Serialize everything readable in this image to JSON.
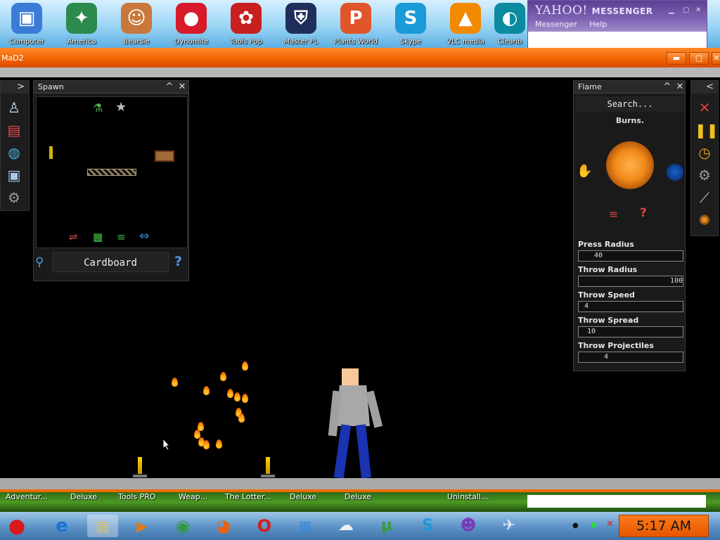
{
  "desktop": {
    "icons": [
      {
        "label": "Computer",
        "icon": "computer-icon",
        "color": "#3b7bd8",
        "glyph": "▣"
      },
      {
        "label": "America",
        "icon": "globe-compass-icon",
        "color": "#2c8a4c",
        "glyph": "✦"
      },
      {
        "label": "Bearsie",
        "icon": "girl-face-icon",
        "color": "#c9773b",
        "glyph": "☺"
      },
      {
        "label": "Dynomite",
        "icon": "mushroom-ball-icon",
        "color": "#d81a2a",
        "glyph": "●"
      },
      {
        "label": "Tools Pop",
        "icon": "turkey-icon",
        "color": "#c81f1f",
        "glyph": "✿"
      },
      {
        "label": "Master PL",
        "icon": "shield-mpl-icon",
        "color": "#1f2e5a",
        "glyph": "⛨"
      },
      {
        "label": "Plants World",
        "icon": "p-badge-icon",
        "color": "#e0552a",
        "glyph": "P"
      },
      {
        "label": "Skype",
        "icon": "skype-icon",
        "color": "#1a9ad8",
        "glyph": "S"
      },
      {
        "label": "VLC media",
        "icon": "vlc-cone-icon",
        "color": "#f28a00",
        "glyph": "▲"
      },
      {
        "label": "Cleanb",
        "icon": "cleaner-icon",
        "color": "#0b8aa0",
        "glyph": "◐"
      }
    ]
  },
  "yahoo": {
    "brand": "YAHOO!",
    "sub": "MESSENGER",
    "menu": [
      "Messenger",
      "Help"
    ]
  },
  "window": {
    "title": "MaD2",
    "min": "▬",
    "max": "□",
    "close": "✕"
  },
  "spawn": {
    "title": "Spawn",
    "collapse": "^",
    "close": "✕",
    "search_label": "Cardboard",
    "help": "?"
  },
  "flame": {
    "title": "Flame",
    "collapse": "^",
    "close": "✕",
    "search_placeholder": "Search...",
    "description": "Burns.",
    "help": "?",
    "fields": [
      {
        "label": "Press Radius",
        "value": "40"
      },
      {
        "label": "Throw Radius",
        "value": "100"
      },
      {
        "label": "Throw Speed",
        "value": "4"
      },
      {
        "label": "Throw Spread",
        "value": "10"
      },
      {
        "label": "Throw Projectiles",
        "value": "4"
      }
    ]
  },
  "left_toolbar": {
    "expand": ">"
  },
  "right_toolbar": {
    "expand": "<"
  },
  "taskbar_top": {
    "items": [
      "Adventur...",
      "Deluxe",
      "Tools PRO",
      "Weap...",
      "The Lotter...",
      "Deluxe",
      "Deluxe",
      "Uninstall..."
    ]
  },
  "taskbar": {
    "apps": [
      {
        "icon": "angry-bird-icon",
        "color": "#d81a1a",
        "glyph": "●"
      },
      {
        "icon": "internet-explorer-icon",
        "color": "#1a72d8",
        "glyph": "e"
      },
      {
        "icon": "folder-icon",
        "color": "#e8c44a",
        "glyph": "▤"
      },
      {
        "icon": "media-player-icon",
        "color": "#e07b1a",
        "glyph": "▶"
      },
      {
        "icon": "chrome-icon",
        "color": "#2f9a3a",
        "glyph": "◉"
      },
      {
        "icon": "firefox-icon",
        "color": "#e0651a",
        "glyph": "◕"
      },
      {
        "icon": "opera-icon",
        "color": "#d81a1a",
        "glyph": "O"
      },
      {
        "icon": "windows-icon",
        "color": "#3a8ad8",
        "glyph": "▦"
      },
      {
        "icon": "google-talk-icon",
        "color": "#c8c8c8",
        "glyph": "☁"
      },
      {
        "icon": "utorrent-icon",
        "color": "#3a9a3a",
        "glyph": "µ"
      },
      {
        "icon": "skype-icon",
        "color": "#1a9ad8",
        "glyph": "S"
      },
      {
        "icon": "yahoo-messenger-icon",
        "color": "#7a3ab8",
        "glyph": "☻"
      },
      {
        "icon": "game-figure-icon",
        "color": "#8aa8c8",
        "glyph": "✈"
      }
    ],
    "clock": "5:17 AM"
  }
}
